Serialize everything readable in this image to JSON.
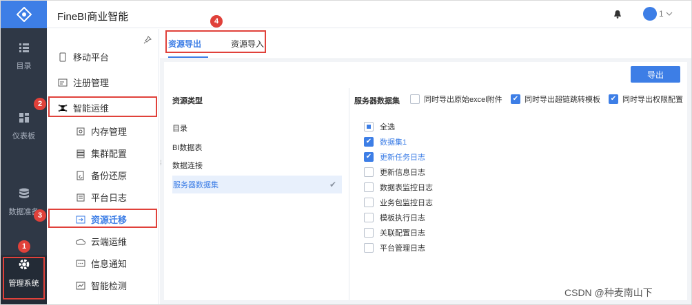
{
  "header": {
    "title": "FineBI商业智能",
    "user_label": "1"
  },
  "rail": {
    "items": [
      {
        "label": "目录",
        "icon": "list-icon"
      },
      {
        "label": "仪表板",
        "icon": "dashboard-icon"
      },
      {
        "label": "数据准备",
        "icon": "database-icon"
      },
      {
        "label": "管理系统",
        "icon": "gear-icon"
      }
    ]
  },
  "sidebar": {
    "items": [
      {
        "label": "移动平台",
        "icon": "mobile-icon"
      },
      {
        "label": "注册管理",
        "icon": "register-icon"
      },
      {
        "label": "智能运维",
        "icon": "ops-icon"
      },
      {
        "label": "内存管理",
        "icon": "memory-icon"
      },
      {
        "label": "集群配置",
        "icon": "cluster-icon"
      },
      {
        "label": "备份还原",
        "icon": "backup-icon"
      },
      {
        "label": "平台日志",
        "icon": "log-icon"
      },
      {
        "label": "资源迁移",
        "icon": "migrate-icon"
      },
      {
        "label": "云端运维",
        "icon": "cloud-icon"
      },
      {
        "label": "信息通知",
        "icon": "message-icon"
      },
      {
        "label": "智能检测",
        "icon": "detect-icon"
      }
    ]
  },
  "tabs": [
    {
      "label": "资源导出"
    },
    {
      "label": "资源导入"
    }
  ],
  "panel": {
    "export_label": "导出",
    "resource_type_title": "资源类型",
    "resource_types": [
      "目录",
      "BI数据表",
      "数据连接",
      "服务器数据集"
    ],
    "server_dataset_title": "服务器数据集",
    "options": [
      {
        "label": "同时导出原始excel附件",
        "checked": false
      },
      {
        "label": "同时导出超链跳转模板",
        "checked": true
      },
      {
        "label": "同时导出权限配置",
        "checked": true
      }
    ],
    "datasets": [
      {
        "label": "全选",
        "state": "partial"
      },
      {
        "label": "数据集1",
        "state": "checked"
      },
      {
        "label": "更新任务日志",
        "state": "checked"
      },
      {
        "label": "更新信息日志",
        "state": "unchecked"
      },
      {
        "label": "数据表监控日志",
        "state": "unchecked"
      },
      {
        "label": "业务包监控日志",
        "state": "unchecked"
      },
      {
        "label": "模板执行日志",
        "state": "unchecked"
      },
      {
        "label": "关联配置日志",
        "state": "unchecked"
      },
      {
        "label": "平台管理日志",
        "state": "unchecked"
      }
    ]
  },
  "annotations": [
    "1",
    "2",
    "3",
    "4"
  ],
  "watermark": "CSDN @种麦南山下",
  "colors": {
    "accent": "#3d7ee6",
    "rail": "#2f3846",
    "annotation": "#e0413a"
  }
}
